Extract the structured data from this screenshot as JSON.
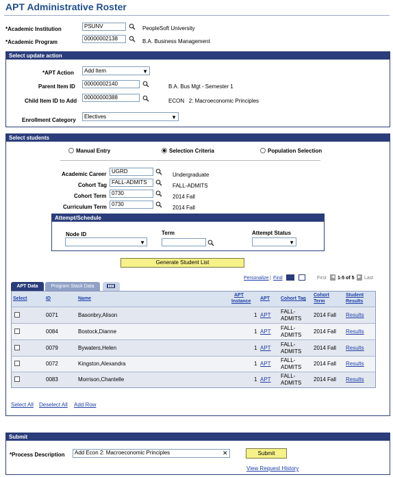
{
  "page": {
    "title": "APT Administrative Roster"
  },
  "header": {
    "institution_label": "*Academic Institution",
    "institution_value": "PSUNV",
    "institution_desc": "PeopleSoft University",
    "program_label": "*Academic Program",
    "program_value": "00000002138",
    "program_desc": "B.A. Business Management"
  },
  "update": {
    "section_title": "Select update action",
    "apt_action_label": "*APT Action",
    "apt_action_value": "Add Item",
    "parent_label": "Parent Item ID",
    "parent_value": "00000002140",
    "parent_desc": "B.A. Bus Mgt - Semester 1",
    "child_label": "Child Item ID to Add",
    "child_value": "00000000388",
    "child_desc": "ECON   2: Macroeconomic Principles",
    "category_label": "Enrollment Category",
    "category_value": "Electives"
  },
  "students": {
    "section_title": "Select students",
    "radio_manual": "Manual Entry",
    "radio_criteria": "Selection Criteria",
    "radio_population": "Population Selection",
    "career_label": "Academic Career",
    "career_value": "UGRD",
    "career_desc": "Undergraduate",
    "cohort_tag_label": "Cohort Tag",
    "cohort_tag_value": "FALL-ADMITS",
    "cohort_tag_desc": "FALL-ADMITS",
    "cohort_term_label": "Cohort Term",
    "cohort_term_value": "0730",
    "cohort_term_desc": "2014 Fall",
    "curr_term_label": "Curriculum Term",
    "curr_term_value": "0730",
    "curr_term_desc": "2014 Fall",
    "attempt": {
      "title": "Attempt/Schedule",
      "node_label": "Node ID",
      "term_label": "Term",
      "status_label": "Attempt Status"
    },
    "generate_label": "Generate Student List"
  },
  "grid": {
    "tab_apt": "APT Data",
    "tab_stack": "Program Stack Data",
    "personalize": "Personalize",
    "find": "Find",
    "first": "First",
    "range": "1-5 of 5",
    "last": "Last",
    "columns": {
      "select": "Select",
      "id": "ID",
      "name": "Name",
      "apt_instance_1": "APT",
      "apt_instance_2": "Instance",
      "apt": "APT",
      "cohort_tag": "Cohort Tag",
      "cohort_term_1": "Cohort",
      "cohort_term_2": "Term",
      "results_1": "Student",
      "results_2": "Results"
    },
    "rows": [
      {
        "id": "0071",
        "name": "Basonbry,Alison",
        "instance": "1",
        "apt": "APT",
        "tag_1": "FALL-",
        "tag_2": "ADMITS",
        "term": "2014 Fall",
        "results": "Results"
      },
      {
        "id": "0084",
        "name": "Bostock,Dianne",
        "instance": "1",
        "apt": "APT",
        "tag_1": "FALL-",
        "tag_2": "ADMITS",
        "term": "2014 Fall",
        "results": "Results"
      },
      {
        "id": "0079",
        "name": "Bywaters,Helen",
        "instance": "1",
        "apt": "APT",
        "tag_1": "FALL-",
        "tag_2": "ADMITS",
        "term": "2014 Fall",
        "results": "Results"
      },
      {
        "id": "0072",
        "name": "Kingston,Alexandra",
        "instance": "1",
        "apt": "APT",
        "tag_1": "FALL-",
        "tag_2": "ADMITS",
        "term": "2014 Fall",
        "results": "Results"
      },
      {
        "id": "0083",
        "name": "Morrison,Chantelle",
        "instance": "1",
        "apt": "APT",
        "tag_1": "FALL-",
        "tag_2": "ADMITS",
        "term": "2014 Fall",
        "results": "Results"
      }
    ],
    "select_all": "Select All",
    "deselect_all": "Deselect All",
    "add_row": "Add Row"
  },
  "submit": {
    "section_title": "Submit",
    "desc_label": "*Process Description",
    "desc_value": "Add Econ 2: Macroeconomic Principles",
    "submit_label": "Submit",
    "history_link": "View Request History"
  },
  "colors": {
    "header_bar": "#2a3c79",
    "title": "#1f4e8c",
    "link": "#1c3ea8",
    "button": "#f6f289",
    "grid_header": "#d9e2ef",
    "grid_body": "#dfe4ee"
  }
}
